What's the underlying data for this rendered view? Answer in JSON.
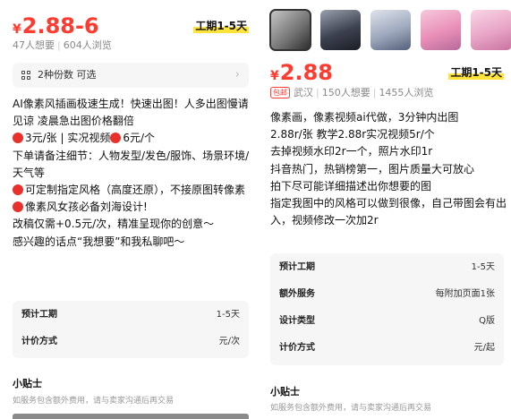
{
  "left": {
    "price": {
      "currency": "¥",
      "value": "2.88-6"
    },
    "period": "工期1-5天",
    "stats": {
      "wants": "47人想要",
      "views": "604人浏览"
    },
    "specs": {
      "label": "2种份数 可选"
    },
    "description": [
      "AI像素风插画极速生成！快速出图！人多出图慢请见谅 凌晨急出图价格翻倍",
      "3元/张 | 实况视频",
      "6元/个",
      "下单请备注细节：人物发型/发色/服饰、场景环境/天气等",
      "可定制指定风格（高度还原），不接原图转像素",
      "像素风女孩必备刘海设计!",
      "改稿仅需+0.5元/次，精准呈现你的创意～",
      "感兴趣的话点“我想要”和我私聊吧～"
    ],
    "info": [
      {
        "label": "预计工期",
        "value": "1-5天"
      },
      {
        "label": "计价方式",
        "value": "元/次"
      }
    ],
    "tips": {
      "title": "小贴士",
      "text": "如服务包含额外费用，请与卖家沟通后再交易"
    }
  },
  "right": {
    "price": {
      "currency": "¥",
      "value": "2.88"
    },
    "period": "工期1-5天",
    "badge": "包邮",
    "stats": {
      "location": "武汉",
      "wants": "150人想要",
      "views": "1455人浏览"
    },
    "description": [
      "像素画，像素视频ai代做，3分钟内出图",
      "2.88r/张  教学2.88r实况视频5r/个",
      "去掉视频水印2r一个，照片水印1r",
      "抖音热门，热销榜第一，图片质量大可放心",
      "拍下尽可能详细描述出你想要的图",
      "指定我图中的风格可以做到很像，自己带图会有出入，视频修改一次加2r"
    ],
    "info": [
      {
        "label": "预计工期",
        "value": "1-5天"
      },
      {
        "label": "额外服务",
        "value": "每附加页面1张"
      },
      {
        "label": "设计类型",
        "value": "Q版"
      },
      {
        "label": "计价方式",
        "value": "元/起"
      }
    ],
    "tips": {
      "title": "小贴士",
      "text": "如服务包含额外费用，请与卖家沟通后再交易"
    }
  },
  "colors": {
    "price": "#ff3b30",
    "highlight": "#ffe23a",
    "panel": "#f6f6f6",
    "dot": "#e8312a"
  }
}
